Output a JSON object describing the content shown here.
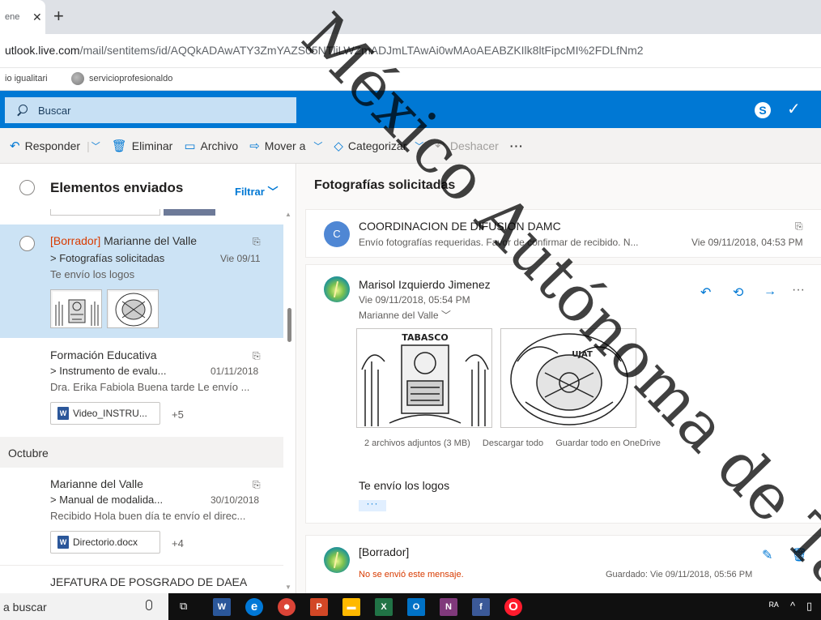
{
  "browser": {
    "tab_title": "ene",
    "close_glyph": "✕",
    "new_tab_glyph": "+",
    "url_host": "utlook.live.com",
    "url_path": "/mail/sentitems/id/AQQkADAwATY3ZmYAZS05NTliLWZmADJmLTAwAi0wMAoAEABZKIlk8ltFipcMI%2FDLfNm2",
    "bookmarks": [
      "io igualitari",
      "servicioprofesionaldo"
    ]
  },
  "header": {
    "search_placeholder": "Buscar",
    "skype_glyph": "S",
    "premium_glyph": "✓"
  },
  "toolbar": {
    "reply": "Responder",
    "delete": "Eliminar",
    "archive": "Archivo",
    "move": "Mover a",
    "categorize": "Categorizar",
    "undo": "Deshacer",
    "more": "···"
  },
  "list": {
    "title": "Elementos enviados",
    "filter": "Filtrar",
    "items": [
      {
        "draft_tag": "[Borrador]",
        "sender": " Marianne del Valle",
        "subject": "> Fotografías solicitadas",
        "date": "Vie 09/11",
        "preview": "Te envío los logos"
      },
      {
        "sender": "Formación Educativa",
        "subject": "> Instrumento de evalu...",
        "date": "01/11/2018",
        "preview": "Dra. Erika Fabiola Buena tarde Le envío ...",
        "attachment": "Video_INSTRU...",
        "more_count": "+5"
      },
      {
        "sender": "Marianne del Valle",
        "subject": "> Manual de modalida...",
        "date": "30/10/2018",
        "preview": "Recibido Hola buen día te envío el direc...",
        "attachment": "Directorio.docx",
        "more_count": "+4"
      },
      {
        "sender": "JEFATURA DE POSGRADO DE DAEA"
      }
    ],
    "section_october": "Octubre"
  },
  "reading": {
    "title": "Fotografías solicitadas",
    "msg1": {
      "avatar": "C",
      "sender": "COORDINACION DE DIFUSION DAMC",
      "preview": "Envío fotografías requeridas. Favor de confirmar de recibido. N...",
      "date": "Vie 09/11/2018, 04:53 PM"
    },
    "msg2": {
      "sender": "Marisol Izquierdo Jimenez",
      "date": "Vie 09/11/2018, 05:54 PM",
      "to": "Marianne del Valle",
      "attachments_info": "2 archivos adjuntos (3 MB)",
      "download_all": "Descargar todo",
      "save_onedrive": "Guardar todo en OneDrive",
      "body": "Te envío los logos",
      "expand": "···",
      "image1_label": "TABASCO",
      "image2_label": "UJAT"
    },
    "msg3": {
      "draft_tag": "[Borrador]",
      "not_sent": "No se envió este mensaje.",
      "saved": "Guardado: Vie 09/11/2018, 05:56 PM"
    }
  },
  "watermark": "México Autónoma de Ta",
  "taskbar": {
    "search_text": "a buscar",
    "apps": [
      {
        "name": "word",
        "glyph": "W",
        "color": "#2b579a"
      },
      {
        "name": "edge",
        "glyph": "e",
        "color": "#0078d7"
      },
      {
        "name": "chrome",
        "glyph": "●",
        "color": "#db4437"
      },
      {
        "name": "powerpoint",
        "glyph": "P",
        "color": "#d24726"
      },
      {
        "name": "explorer",
        "glyph": "▬",
        "color": "#ffb900"
      },
      {
        "name": "excel",
        "glyph": "X",
        "color": "#217346"
      },
      {
        "name": "outlook",
        "glyph": "O",
        "color": "#0072c6"
      },
      {
        "name": "onenote",
        "glyph": "N",
        "color": "#80397b"
      },
      {
        "name": "facebook",
        "glyph": "f",
        "color": "#3b5998"
      },
      {
        "name": "opera",
        "glyph": "O",
        "color": "#ff1b2d"
      }
    ]
  }
}
